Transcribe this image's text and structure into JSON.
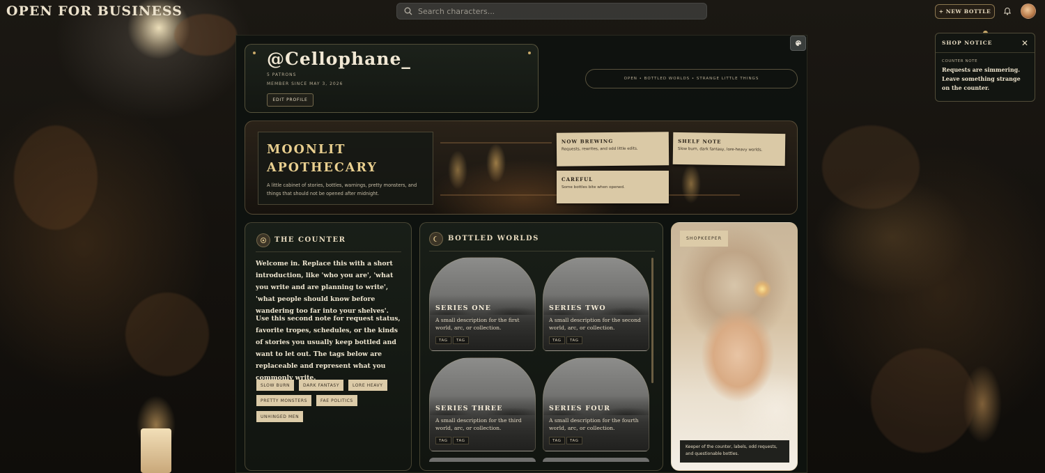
{
  "header": {
    "brand": "OPEN FOR BUSINESS",
    "search_placeholder": "Search characters...",
    "new_bottle_label": "+ NEW BOTTLE"
  },
  "notice": {
    "title": "SHOP NOTICE",
    "close": "✕",
    "subtitle": "COUNTER NOTE",
    "body": "Requests are simmering. Leave something strange on the counter."
  },
  "profile": {
    "username": "@Cellophane_",
    "patrons": "5 PATRONS",
    "member_since": "MEMBER SINCE MAY 3, 2026",
    "edit_label": "EDIT PROFILE",
    "tagline": "OPEN • BOTTLED WORLDS • STRANGE LITTLE THINGS"
  },
  "banner": {
    "title_line1": "MOONLIT",
    "title_line2": "APOTHECARY",
    "description": "A little cabinet of stories, bottles, warnings, pretty monsters, and things that should not be opened after midnight.",
    "notes": [
      {
        "title": "NOW BREWING",
        "body": "Requests, rewrites, and odd little edits."
      },
      {
        "title": "SHELF NOTE",
        "body": "Slow burn, dark fantasy, lore-heavy worlds."
      },
      {
        "title": "CAREFUL",
        "body": "Some bottles bite when opened."
      }
    ]
  },
  "counter": {
    "title": "THE COUNTER",
    "paragraph1": "Welcome in. Replace this with a short introduction, like 'who you are', 'what you write and are planning to write', 'what people should know before wandering too far into your shelves'.",
    "paragraph2": "Use this second note for request status, favorite tropes, schedules, or the kinds of stories you usually keep bottled and want to let out. The tags below are replaceable and represent what you commonly write.",
    "tags": [
      "SLOW BURN",
      "DARK FANTASY",
      "LORE HEAVY",
      "PRETTY MONSTERS",
      "FAE POLITICS",
      "UNHINGED MEN"
    ]
  },
  "worlds": {
    "title": "BOTTLED WORLDS",
    "series": [
      {
        "title": "SERIES ONE",
        "desc": "A small description for the first world, arc, or collection.",
        "tags": [
          "TAG",
          "TAG"
        ]
      },
      {
        "title": "SERIES TWO",
        "desc": "A small description for the second world, arc, or collection.",
        "tags": [
          "TAG",
          "TAG"
        ]
      },
      {
        "title": "SERIES THREE",
        "desc": "A small description for the third world, arc, or collection.",
        "tags": [
          "TAG",
          "TAG"
        ]
      },
      {
        "title": "SERIES FOUR",
        "desc": "A small description for the fourth world, arc, or collection.",
        "tags": [
          "TAG",
          "TAG"
        ]
      }
    ]
  },
  "shopkeeper": {
    "label": "SHOPKEEPER",
    "caption": "Keeper of the counter, labels, odd requests, and questionable bottles."
  },
  "colors": {
    "accent_gold": "#c9a96a",
    "parchment": "#dccba8",
    "panel_bg": "#1a2019",
    "text_light": "#efe6d0"
  }
}
